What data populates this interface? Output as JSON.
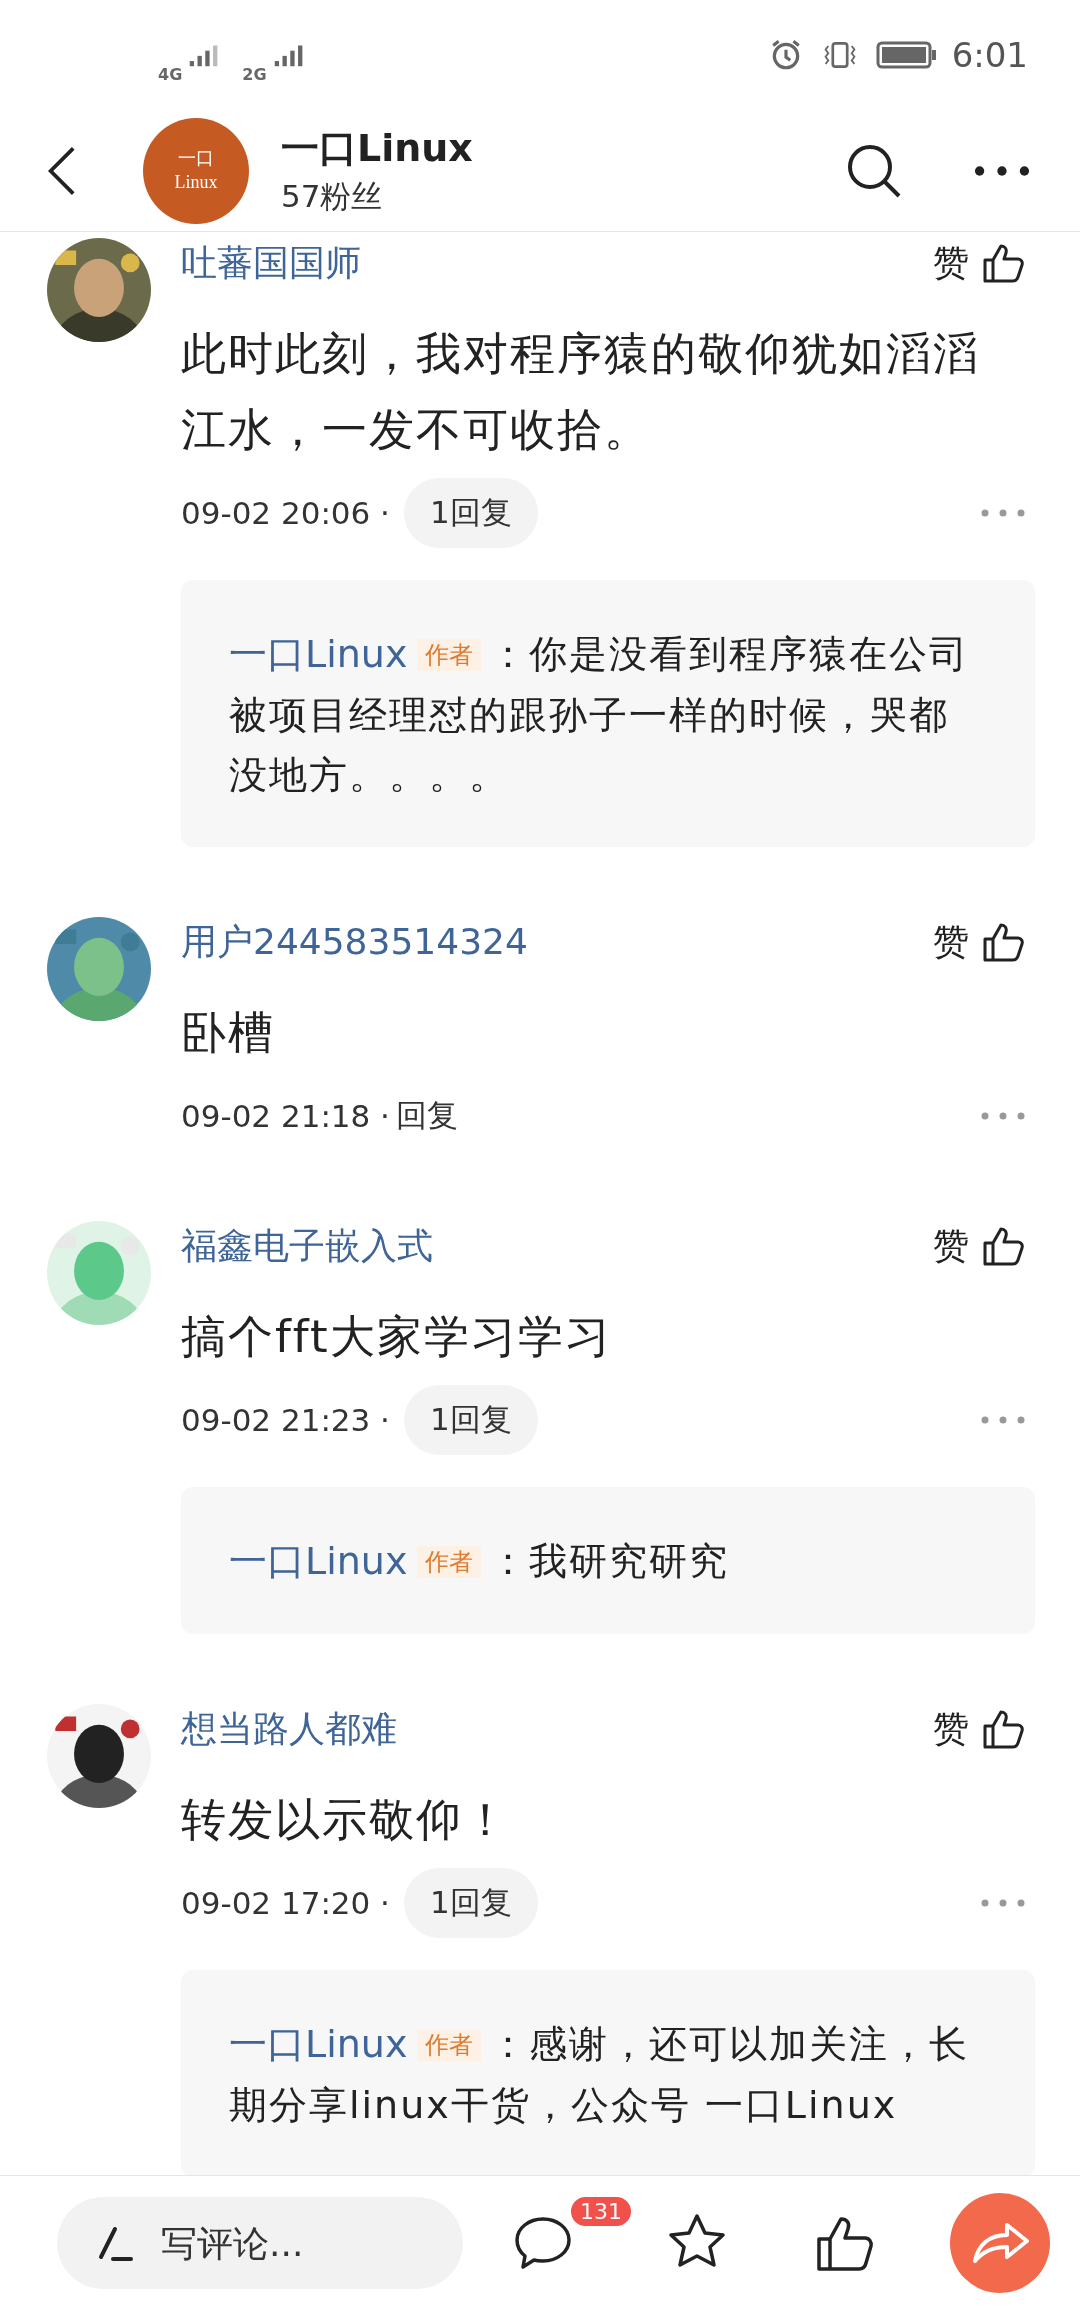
{
  "status_bar": {
    "network_1": "4G",
    "network_2": "2G",
    "time": "6:01"
  },
  "header": {
    "avatar_line_1": "一口",
    "avatar_line_2": "Linux",
    "title": "一口Linux",
    "subtitle": "57粉丝"
  },
  "comments": [
    {
      "user": "吐蕃国国师",
      "like_label": "赞",
      "text": "此时此刻，我对程序猿的敬仰犹如滔滔江水，一发不可收拾。",
      "time": "09-02 20:06 ·",
      "reply_button": {
        "kind": "pill",
        "label": "1回复"
      },
      "replies": [
        {
          "author": "一口Linux",
          "badge": "作者",
          "text": "：你是没看到程序猿在公司被项目经理怼的跟孙子一样的时候，哭都没地方。。。。"
        }
      ]
    },
    {
      "user": "用户244583514324",
      "like_label": "赞",
      "text": "卧槽",
      "time": "09-02 21:18 ·",
      "reply_button": {
        "kind": "plain",
        "label": "回复"
      }
    },
    {
      "user": "福鑫电子嵌入式",
      "like_label": "赞",
      "text": "搞个fft大家学习学习",
      "time": "09-02 21:23 ·",
      "reply_button": {
        "kind": "pill",
        "label": "1回复"
      },
      "replies": [
        {
          "author": "一口Linux",
          "badge": "作者",
          "text": "：我研究研究"
        }
      ]
    },
    {
      "user": "想当路人都难",
      "like_label": "赞",
      "text": "转发以示敬仰！",
      "time": "09-02 17:20 ·",
      "reply_button": {
        "kind": "pill",
        "label": "1回复"
      },
      "replies": [
        {
          "author": "一口Linux",
          "badge": "作者",
          "text": "：感谢，还可以加关注，长期分享linux干货，公众号 一口Linux"
        }
      ]
    }
  ],
  "bottom_bar": {
    "comment_placeholder": "写评论...",
    "comment_count": "131"
  }
}
